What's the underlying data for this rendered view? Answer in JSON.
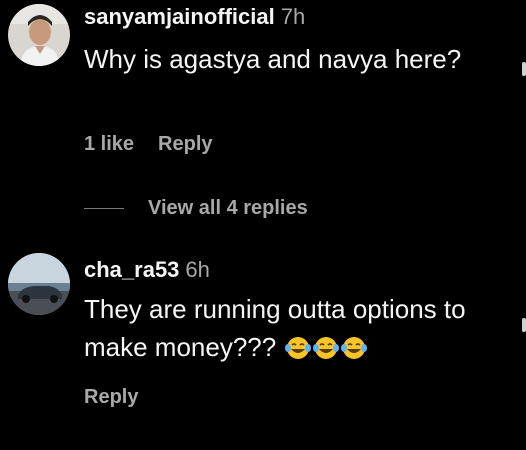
{
  "comments": [
    {
      "username": "sanyamjainofficial",
      "time": "7h",
      "text": "Why is agastya and navya here?",
      "likes": "1 like",
      "reply": "Reply"
    },
    {
      "username": "cha_ra53",
      "time": "6h",
      "text": "They are running outta options to make money???",
      "reply": "Reply",
      "emoji": [
        "face-with-tears-of-joy-icon",
        "face-with-tears-of-joy-icon",
        "face-with-tears-of-joy-icon"
      ]
    }
  ],
  "view_replies": "View all 4 replies",
  "colors": {
    "background": "#000000",
    "primary_text": "#f5f5f5",
    "secondary_text": "#a8a8a8",
    "emoji_yellow": "#f7c52b"
  }
}
